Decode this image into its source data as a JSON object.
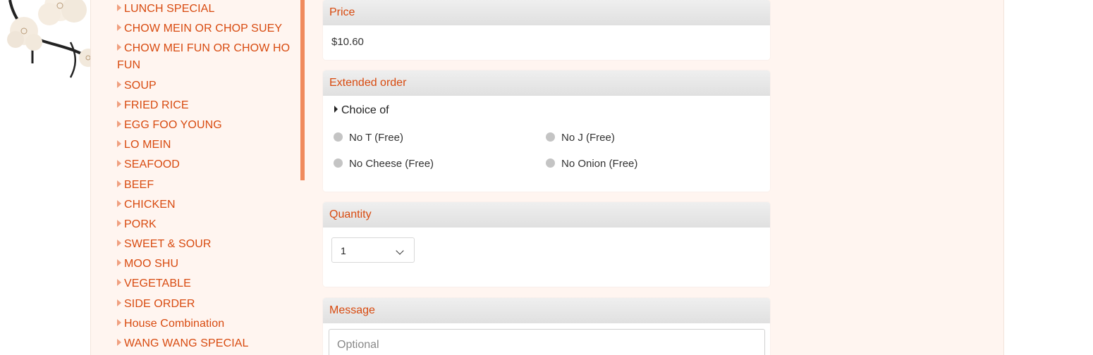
{
  "sidebar": {
    "categories": [
      "LUNCH SPECIAL",
      "CHOW MEIN OR CHOP SUEY",
      "CHOW MEI FUN OR CHOW HO FUN",
      "SOUP",
      "FRIED RICE",
      "EGG FOO YOUNG",
      "LO MEIN",
      "SEAFOOD",
      "BEEF",
      "CHICKEN",
      "PORK",
      "SWEET & SOUR",
      "MOO SHU",
      "VEGETABLE",
      "SIDE ORDER",
      "House Combination",
      "WANG WANG SPECIAL"
    ]
  },
  "price": {
    "title": "Price",
    "value": "$10.60"
  },
  "extended": {
    "title": "Extended order",
    "choice_title": "Choice of",
    "options": [
      "No T (Free)",
      "No J (Free)",
      "No Cheese (Free)",
      "No Onion (Free)"
    ]
  },
  "quantity": {
    "title": "Quantity",
    "value": "1"
  },
  "message": {
    "title": "Message",
    "placeholder": "Optional"
  },
  "colors": {
    "accent": "#d84a0f",
    "page_bg": "#fff5f0",
    "scrollbar": "#f08a5d",
    "panel_header": "#e6e6e6"
  }
}
